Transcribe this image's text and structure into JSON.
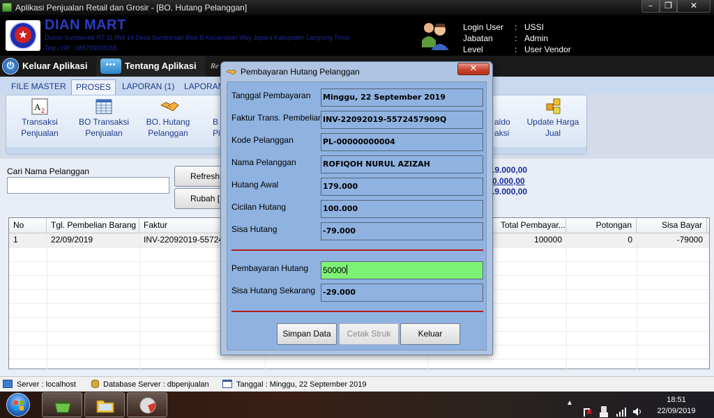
{
  "window": {
    "title": "Aplikasi Penjualan Retail dan Grosir - [BO. Hutang Pelanggan]",
    "minimize": "–",
    "maximize": "❐",
    "close": "✕"
  },
  "header": {
    "store_name": "DIAN MART",
    "address": "Dusun Sumberadi RT 11 RW 14 Desa Sumbersari Blok B Kecamatan Way Jepara Kabupaten Lampung Timur",
    "phone": "Telp./ HP   :  085789938155",
    "login": [
      {
        "key": "Login User",
        "value": "USSI"
      },
      {
        "key": "Jabatan",
        "value": "Admin"
      },
      {
        "key": "Level",
        "value": "User Vendor"
      }
    ],
    "separator": ":"
  },
  "topbar": {
    "keluar_label": "Keluar Aplikasi",
    "tentang_label": "Tentang Aplikasi",
    "tentang_icon_text": "•••",
    "cut_text": "Re"
  },
  "menu": {
    "tabs": [
      "FILE MASTER",
      "PROSES",
      "LAPORAN (1)",
      "LAPORAN"
    ],
    "active_tab": "PROSES"
  },
  "ribbon": {
    "items": [
      {
        "label_1": "Transaksi",
        "label_2": "Penjualan",
        "icon": "a2-icon"
      },
      {
        "label_1": "BO Transaksi",
        "label_2": "Penjualan",
        "icon": "spreadsheet-icon"
      },
      {
        "label_1": "BO. Hutang",
        "label_2": "Pelanggan",
        "icon": "handshake-icon"
      },
      {
        "label_1": "B",
        "label_2": "Pi",
        "icon": "partial"
      },
      {
        "label_1": "aldo",
        "label_2": "aksi",
        "icon": "partial"
      },
      {
        "label_1": "Update Harga",
        "label_2": "Jual",
        "icon": "blocks-icon"
      }
    ]
  },
  "main": {
    "search_label": "Cari Nama Pelanggan",
    "search_value": "",
    "refresh_label": "Refresh [",
    "rubah_label": "Rubah [",
    "totals": [
      ".9.000,00",
      "0.000,00",
      ".9.000,00"
    ]
  },
  "grid": {
    "headers": [
      "No",
      "Tgl. Pembelian Barang",
      "Faktur",
      "Total Pembayar...",
      "Potongan",
      "Sisa Bayar"
    ],
    "rows": [
      {
        "no": "1",
        "tgl": "22/09/2019",
        "faktur": "INV-22092019-557245",
        "total": "100000",
        "potongan": "0",
        "sisa": "-79000"
      }
    ]
  },
  "dialog": {
    "title": "Pembayaran Hutang Pelanggan",
    "close": "✕",
    "fields": [
      {
        "label": "Tanggal Pembayaran",
        "value": "Minggu, 22 September 2019"
      },
      {
        "label": "Faktur Trans. Pembelian",
        "value": "INV-22092019-5572457909Q"
      },
      {
        "label": "Kode Pelanggan",
        "value": "PL-00000000004"
      },
      {
        "label": "Nama Pelanggan",
        "value": "ROFIQOH NURUL AZIZAH"
      },
      {
        "label": "Hutang Awal",
        "value": "179.000"
      },
      {
        "label": "Cicilan Hutang",
        "value": "100.000"
      },
      {
        "label": "Sisa Hutang",
        "value": "-79.000"
      }
    ],
    "payment": {
      "label": "Pembayaran Hutang",
      "value": "50000"
    },
    "remaining": {
      "label": "Sisa Hutang Sekarang",
      "value": "-29.000"
    },
    "buttons": {
      "save": "Simpan Data",
      "print": "Cetak Struk",
      "exit": "Keluar"
    }
  },
  "statusbar": {
    "server": "Server : localhost",
    "database": "Database Server : dbpenjualan",
    "tanggal": "Tanggal : Minggu, 22 September 2019"
  },
  "taskbar": {
    "time": "18:51",
    "date": "22/09/2019"
  },
  "colors": {
    "accent": "#2b3cc4",
    "dialog_bg": "#8fb2e0",
    "input_active": "#7ef275",
    "separator": "#b31a1a"
  }
}
